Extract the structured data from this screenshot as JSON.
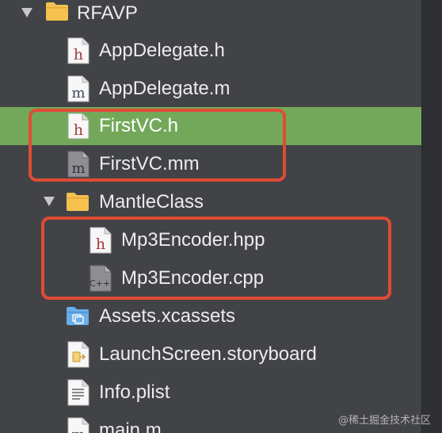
{
  "project": {
    "root_folder": "RFAVP",
    "files": {
      "app_delegate_h": "AppDelegate.h",
      "app_delegate_m": "AppDelegate.m",
      "first_vc_h": "FirstVC.h",
      "first_vc_mm": "FirstVC.mm",
      "assets": "Assets.xcassets",
      "launch_screen": "LaunchScreen.storyboard",
      "info_plist": "Info.plist",
      "main_m": "main.m"
    },
    "group": {
      "name": "MantleClass",
      "files": {
        "mp3_encoder_hpp": "Mp3Encoder.hpp",
        "mp3_encoder_cpp": "Mp3Encoder.cpp"
      }
    }
  },
  "icons": {
    "h_letter": "h",
    "m_letter": "m",
    "cpp_letter": "C++"
  },
  "colors": {
    "selection": "#73a85a",
    "highlight": "#e04b35",
    "folder": "#f5c14f",
    "background": "#414347"
  },
  "watermark": "@稀土掘金技术社区"
}
